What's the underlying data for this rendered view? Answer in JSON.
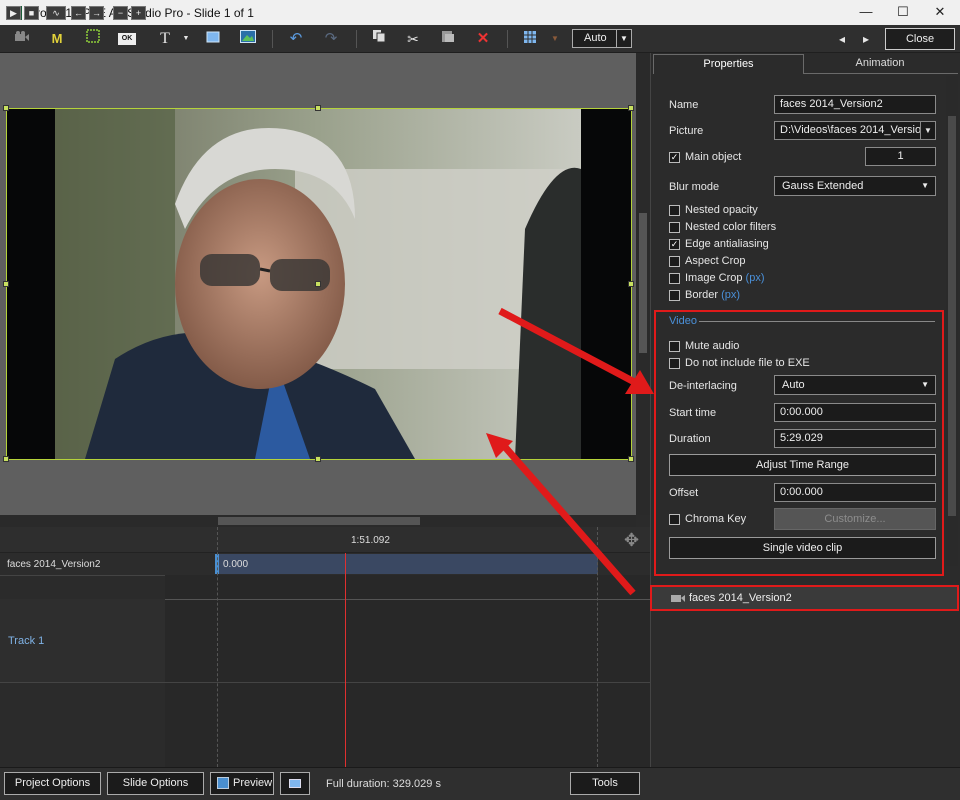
{
  "window": {
    "title": "Project1 - PTE AV Studio Pro - Slide 1 of 1",
    "minimize": "—",
    "maximize": "☐",
    "close": "✕"
  },
  "toolbar": {
    "icons": [
      "camera-icon",
      "mask-icon",
      "frame-icon",
      "ok-button-icon",
      "text-icon",
      "rectangle-icon",
      "image-icon",
      "undo-icon",
      "redo-icon",
      "copy-icon",
      "cut-icon",
      "paste-icon",
      "delete-icon",
      "grid-icon"
    ],
    "mask_label": "M",
    "text_label": "T",
    "ok_label": "OK",
    "zoom_value": "Auto",
    "nav_prev": "◂",
    "nav_next": "▸",
    "close_label": "Close"
  },
  "timeline": {
    "current_time": "1:51.092",
    "object_name": "faces 2014_Version2",
    "clip_start": "0.000",
    "track_name": "Track 1",
    "buttons": [
      "▶",
      "■",
      "∿",
      "←",
      "→",
      "−",
      "+"
    ]
  },
  "properties": {
    "tab_properties": "Properties",
    "tab_animation": "Animation",
    "name_label": "Name",
    "name_value": "faces 2014_Version2",
    "picture_label": "Picture",
    "picture_value": "D:\\Videos\\faces 2014_Version2.mp4",
    "main_object_label": "Main object",
    "main_object_checked": true,
    "main_object_value": "1",
    "blur_mode_label": "Blur mode",
    "blur_mode_value": "Gauss Extended",
    "nested_opacity": "Nested opacity",
    "nested_color_filters": "Nested color filters",
    "edge_antialiasing": "Edge antialiasing",
    "aspect_crop": "Aspect Crop",
    "image_crop": "Image Crop",
    "border": "Border",
    "px": "(px)",
    "check_mark": "✓",
    "video_section": "Video",
    "mute_audio": "Mute audio",
    "do_not_include": "Do not include file to EXE",
    "deinterlacing_label": "De-interlacing",
    "deinterlacing_value": "Auto",
    "start_time_label": "Start time",
    "start_time_value": "0:00.000",
    "duration_label": "Duration",
    "duration_value": "5:29.029",
    "adjust_time_range": "Adjust Time Range",
    "offset_label": "Offset",
    "offset_value": "0:00.000",
    "chroma_key": "Chroma Key",
    "customize": "Customize...",
    "single_video_clip": "Single video clip",
    "object_list_item": "faces 2014_Version2"
  },
  "bottom": {
    "project_options": "Project Options",
    "slide_options": "Slide Options",
    "preview": "Preview",
    "full_duration": "Full duration: 329.029 s",
    "tools": "Tools"
  },
  "colors": {
    "highlight_red": "#e01a1a",
    "selection_frame": "#b5d33a",
    "link_blue": "#4a90d9"
  }
}
